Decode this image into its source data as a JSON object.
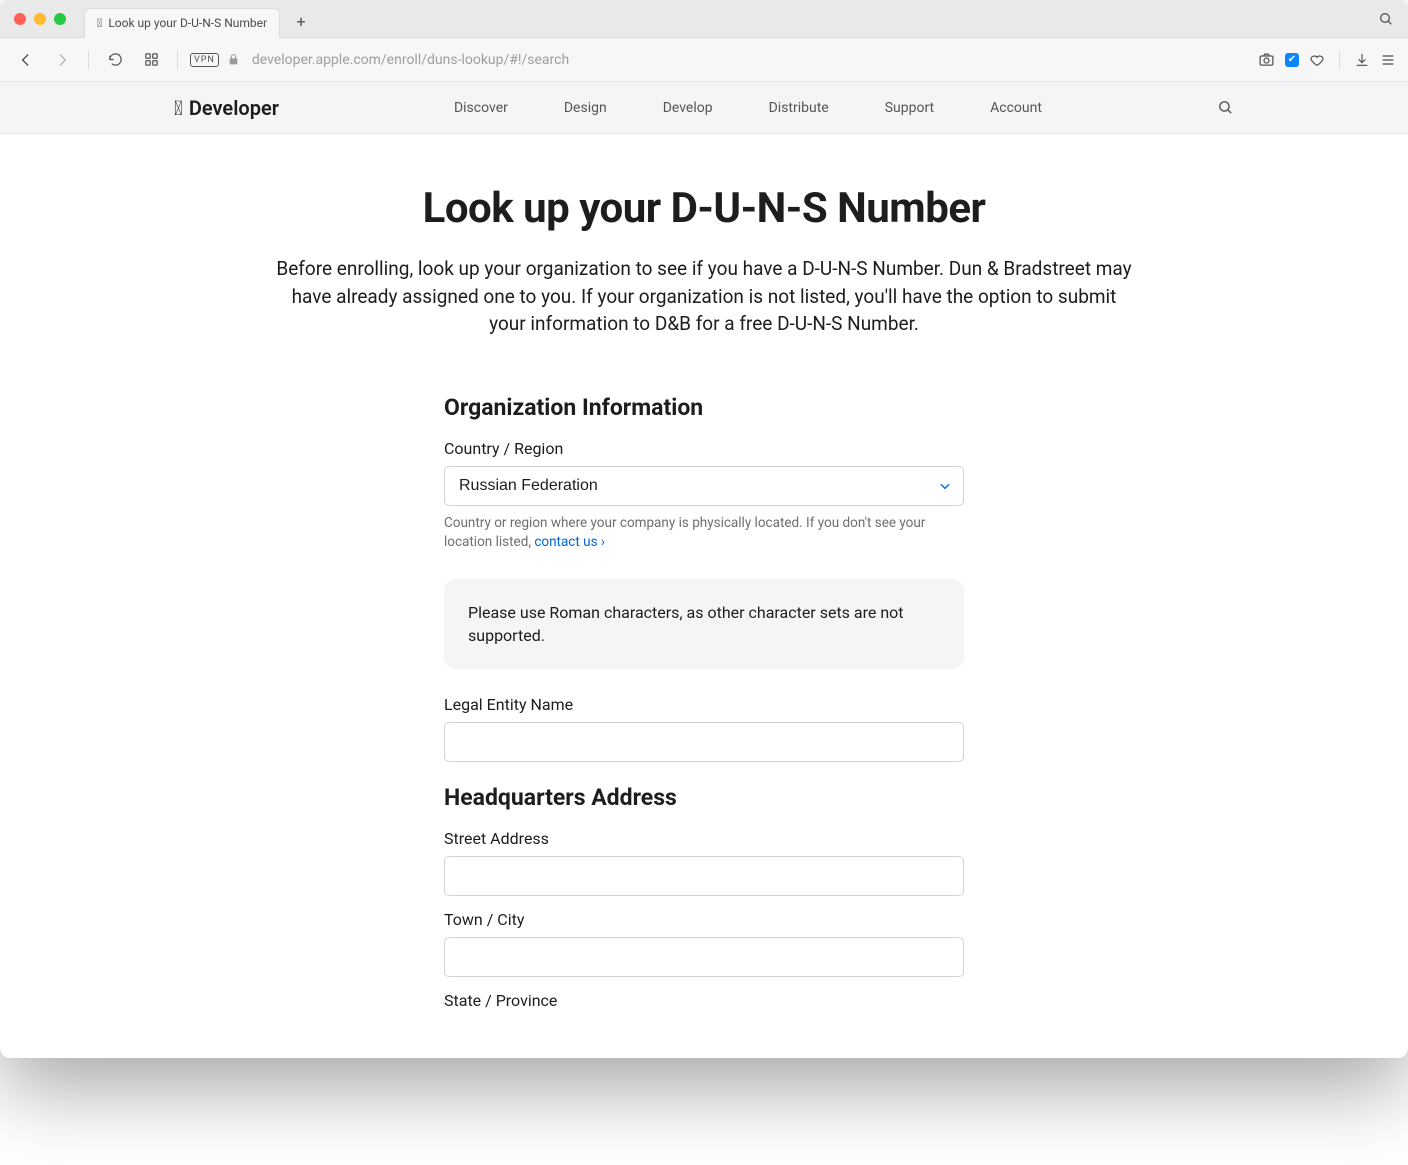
{
  "browser": {
    "tab_title": "Look up your D-U-N-S Number",
    "url": "developer.apple.com/enroll/duns-lookup/#!/search"
  },
  "header": {
    "brand": "Developer",
    "nav": {
      "discover": "Discover",
      "design": "Design",
      "develop": "Develop",
      "distribute": "Distribute",
      "support": "Support",
      "account": "Account"
    }
  },
  "page": {
    "title": "Look up your D-U-N-S Number",
    "intro": "Before enrolling, look up your organization to see if you have a D-U-N-S Number. Dun & Bradstreet may have already assigned one to you. If your organization is not listed, you'll have the option to submit your information to D&B for a free D-U-N-S Number."
  },
  "org": {
    "heading": "Organization Information",
    "country_label": "Country / Region",
    "country_value": "Russian Federation",
    "country_hint": "Country or region where your company is physically located. If you don't see your location listed, ",
    "contact_us": "contact us ›",
    "notice": "Please use Roman characters, as other character sets are not supported.",
    "legal_name_label": "Legal Entity Name",
    "legal_name_value": ""
  },
  "addr": {
    "heading": "Headquarters Address",
    "street_label": "Street Address",
    "street_value": "",
    "town_label": "Town / City",
    "town_value": "",
    "state_label": "State / Province",
    "state_value": ""
  }
}
